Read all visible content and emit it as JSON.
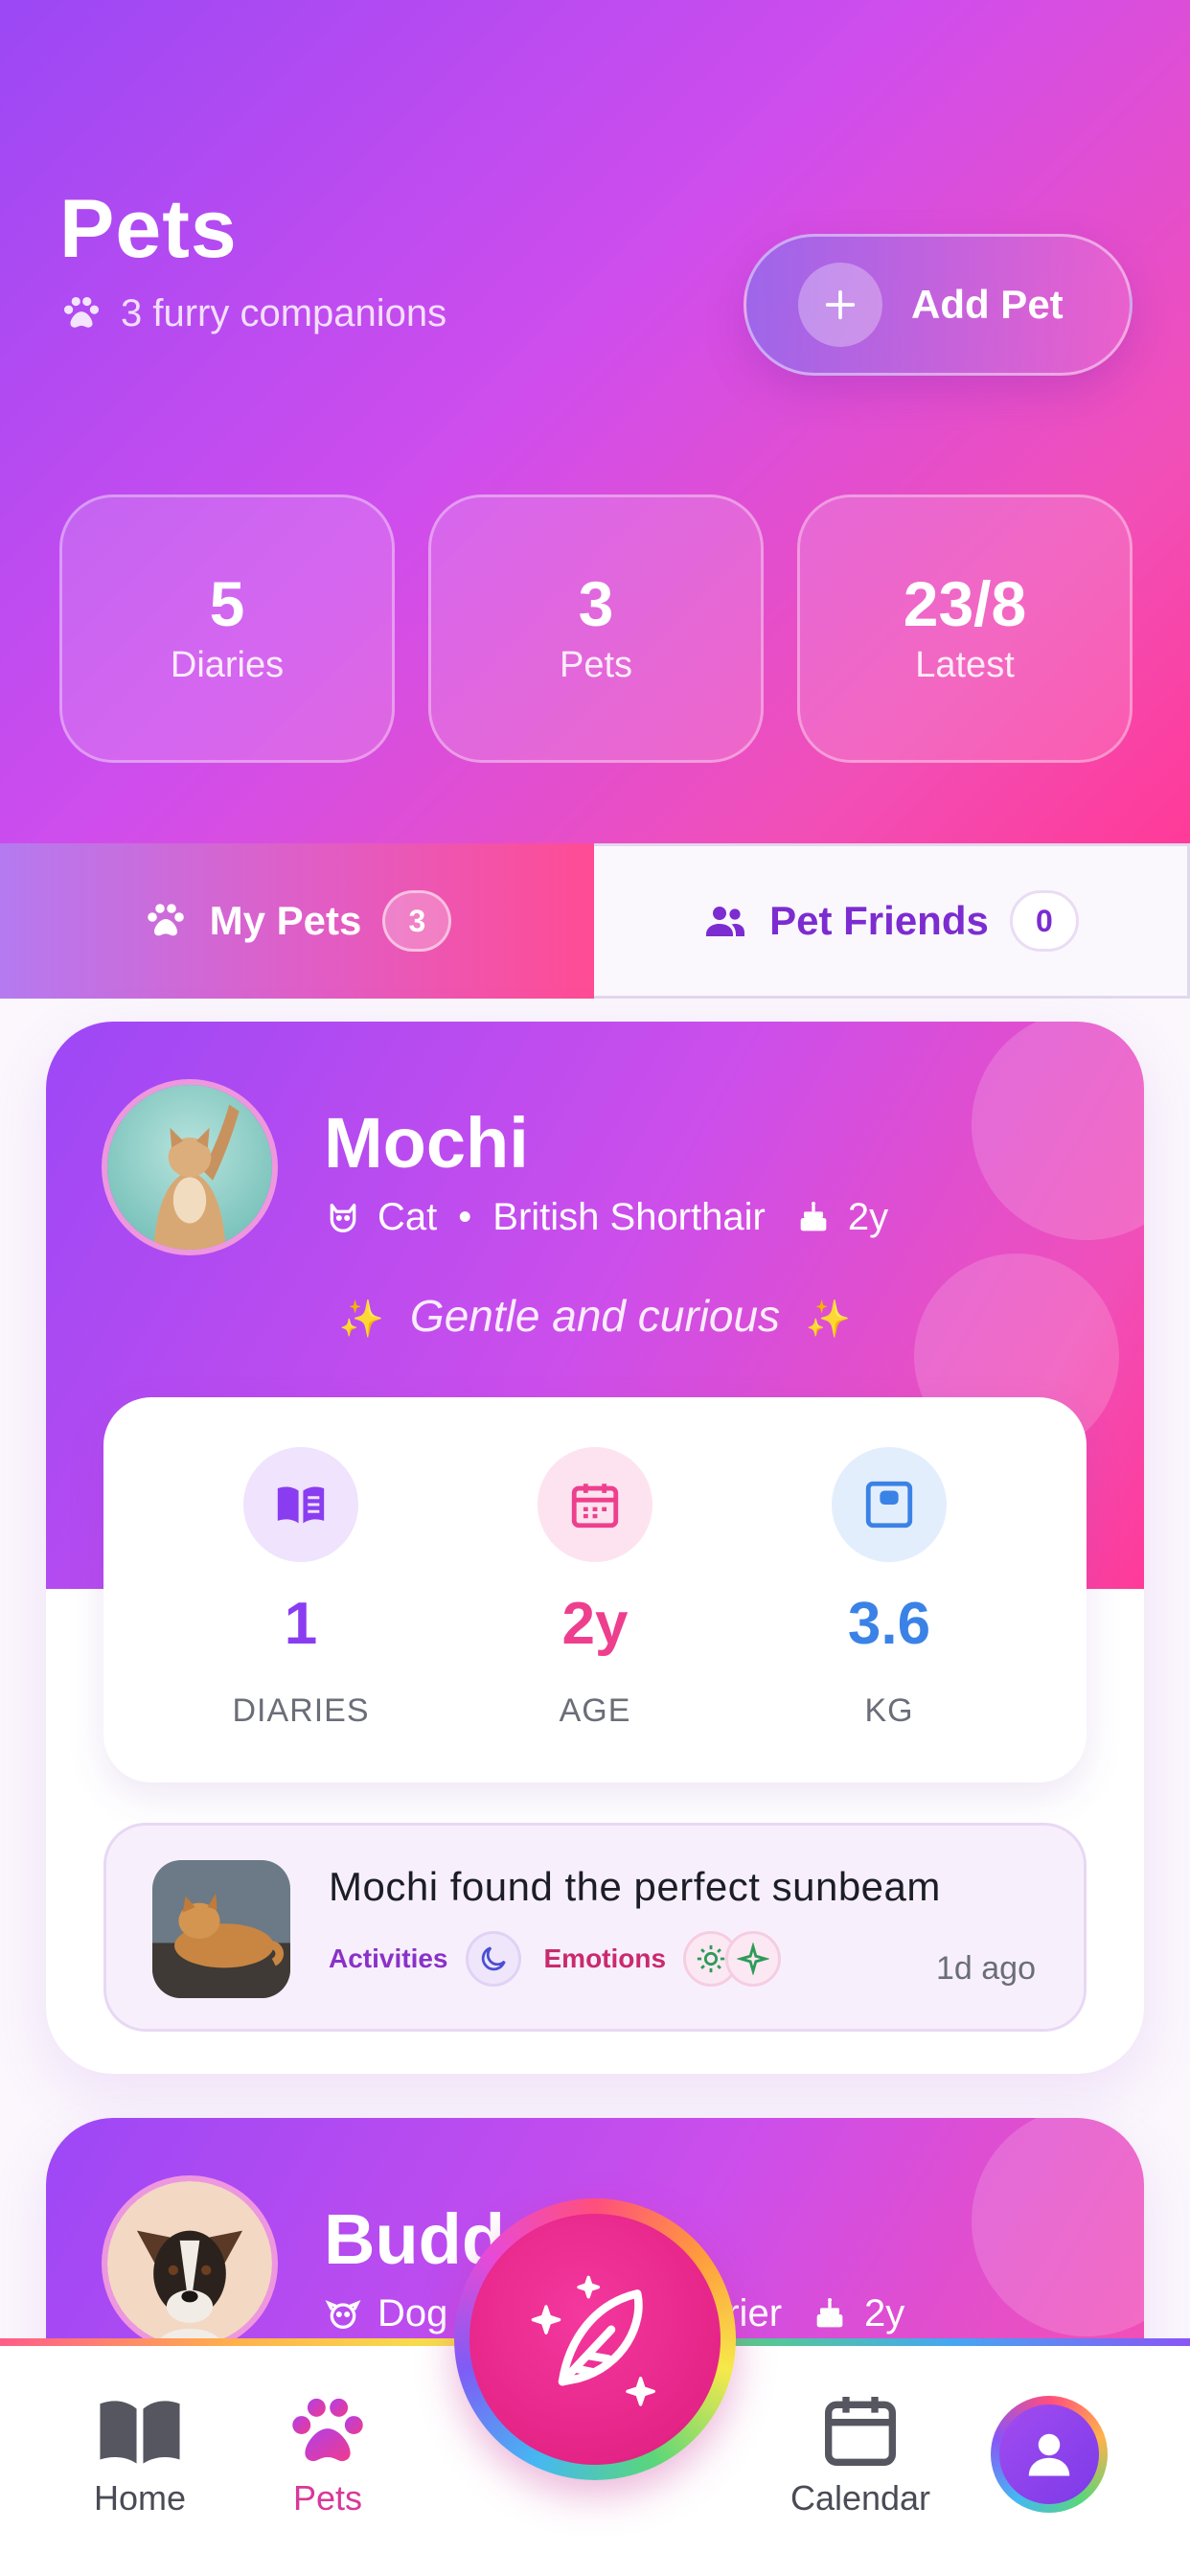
{
  "header": {
    "title": "Pets",
    "subtitle": "3 furry companions",
    "add_button_label": "Add Pet"
  },
  "stats": [
    {
      "value": "5",
      "label": "Diaries"
    },
    {
      "value": "3",
      "label": "Pets"
    },
    {
      "value": "23/8",
      "label": "Latest"
    }
  ],
  "tabs": [
    {
      "label": "My Pets",
      "count": "3",
      "active": true
    },
    {
      "label": "Pet Friends",
      "count": "0",
      "active": false
    }
  ],
  "pets": [
    {
      "name": "Mochi",
      "species": "Cat",
      "breed": "British Shorthair",
      "age": "2y",
      "personality": "Gentle and curious",
      "metrics": [
        {
          "value": "1",
          "label": "DIARIES",
          "color": "#8a3df0",
          "icon": "book-icon"
        },
        {
          "value": "2y",
          "label": "AGE",
          "color": "#ee3f8e",
          "icon": "calendar-icon"
        },
        {
          "value": "3.6",
          "label": "KG",
          "color": "#3b82e6",
          "icon": "scale-icon"
        }
      ],
      "latest_diary": {
        "title": "Mochi found the perfect sunbeam",
        "tags": [
          "Activities",
          "Emotions"
        ],
        "time": "1d ago"
      }
    },
    {
      "name": "Budd",
      "species": "Dog",
      "breed": "l Terrier",
      "age": "2y"
    }
  ],
  "bottom_nav": {
    "items": [
      {
        "label": "Home",
        "icon": "book-open-icon"
      },
      {
        "label": "Pets",
        "icon": "paw-icon",
        "active": true
      },
      {
        "label": "Calendar",
        "icon": "calendar-icon"
      }
    ],
    "fab_icon": "feather-sparkle-icon",
    "profile_icon": "user-icon"
  },
  "colors": {
    "brand_purple": "#9b48f5",
    "brand_pink": "#ff3a98",
    "accent_purple": "#7c2cd0",
    "active_nav": "#d9379b"
  }
}
